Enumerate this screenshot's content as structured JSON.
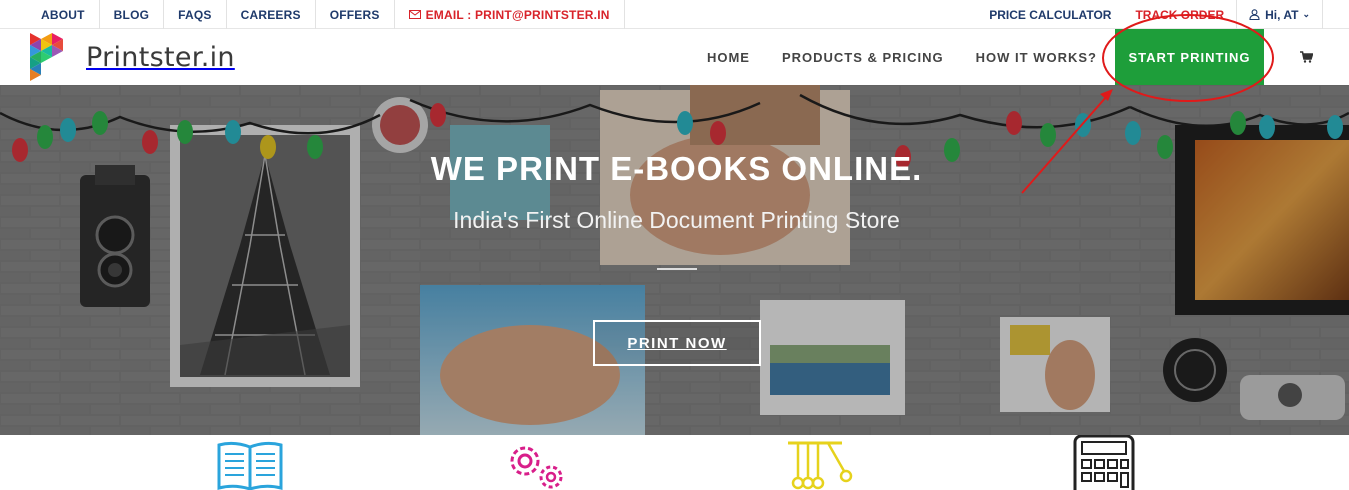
{
  "topbar": {
    "left_links": [
      "ABOUT",
      "BLOG",
      "FAQS",
      "CAREERS",
      "OFFERS"
    ],
    "email_label": "EMAIL : PRINT@PRINTSTER.IN",
    "price_calculator": "PRICE CALCULATOR",
    "track_order": "TRACK ORDER",
    "user_greeting": "Hi, AT"
  },
  "nav": {
    "brand": "Printster.in",
    "items": [
      "HOME",
      "PRODUCTS & PRICING",
      "HOW IT WORKS?"
    ],
    "start_label": "START PRINTING",
    "cart_icon": "shopping-cart-icon"
  },
  "hero": {
    "title": "WE PRINT E-BOOKS ONLINE.",
    "subtitle": "India's First Online Document Printing Store",
    "button": "PRINT NOW"
  },
  "features": {
    "icons": [
      "open-book-icon",
      "gears-icon",
      "newtons-cradle-icon",
      "calculator-icon"
    ]
  },
  "colors": {
    "navy": "#1f3a6b",
    "red": "#d8232a",
    "green": "#1e9e3a",
    "annotation": "#e01a1a"
  }
}
